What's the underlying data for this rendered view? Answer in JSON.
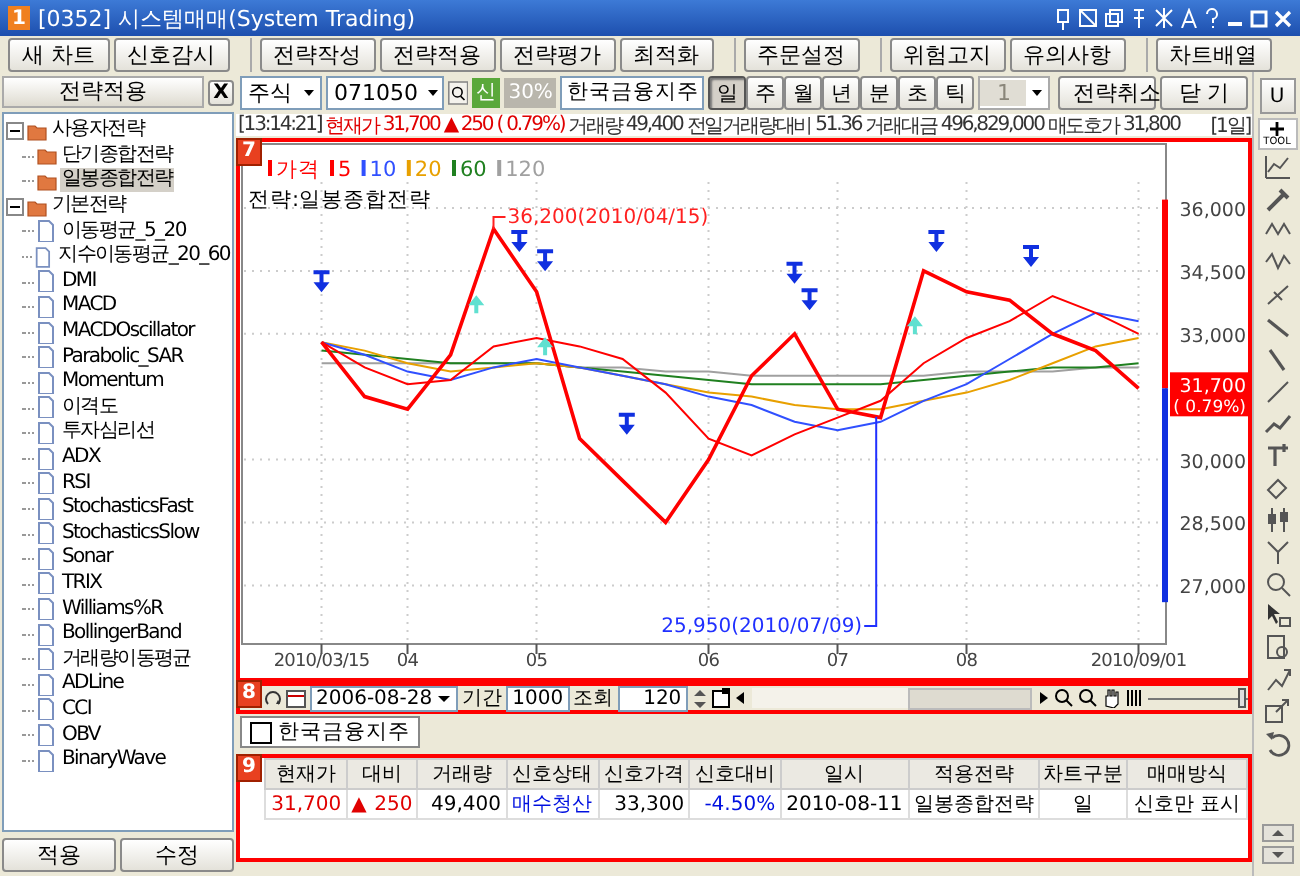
{
  "window": {
    "badge": "1",
    "title": "[0352] 시스템매매(System Trading)"
  },
  "toolbar": {
    "groups": [
      [
        "새 차트",
        "신호감시"
      ],
      [
        "전략작성",
        "전략적용",
        "전략평가",
        "최적화"
      ],
      [
        "주문설정"
      ],
      [
        "위험고지",
        "유의사항"
      ],
      [
        "차트배열"
      ]
    ]
  },
  "sidebar": {
    "title": "전략적용",
    "close": "X",
    "tree": [
      {
        "label": "사용자전략",
        "kind": "folder",
        "expanded": true,
        "selected": false,
        "children": [
          {
            "label": "단기종합전략",
            "kind": "folder",
            "selected": false
          },
          {
            "label": "일봉종합전략",
            "kind": "folder",
            "selected": true
          }
        ]
      },
      {
        "label": "기본전략",
        "kind": "folder",
        "expanded": true,
        "selected": false,
        "children": [
          {
            "label": "이동평균_5_20",
            "kind": "file",
            "selected": false
          },
          {
            "label": "지수이동평균_20_60",
            "kind": "file",
            "selected": false
          },
          {
            "label": "DMI",
            "kind": "file",
            "selected": false
          },
          {
            "label": "MACD",
            "kind": "file",
            "selected": false
          },
          {
            "label": "MACDOscillator",
            "kind": "file",
            "selected": false
          },
          {
            "label": "Parabolic_SAR",
            "kind": "file",
            "selected": false
          },
          {
            "label": "Momentum",
            "kind": "file",
            "selected": false
          },
          {
            "label": "이격도",
            "kind": "file",
            "selected": false
          },
          {
            "label": "투자심리선",
            "kind": "file",
            "selected": false
          },
          {
            "label": "ADX",
            "kind": "file",
            "selected": false
          },
          {
            "label": "RSI",
            "kind": "file",
            "selected": false
          },
          {
            "label": "StochasticsFast",
            "kind": "file",
            "selected": false
          },
          {
            "label": "StochasticsSlow",
            "kind": "file",
            "selected": false
          },
          {
            "label": "Sonar",
            "kind": "file",
            "selected": false
          },
          {
            "label": "TRIX",
            "kind": "file",
            "selected": false
          },
          {
            "label": "Williams%R",
            "kind": "file",
            "selected": false
          },
          {
            "label": "BollingerBand",
            "kind": "file",
            "selected": false
          },
          {
            "label": "거래량이동평균",
            "kind": "file",
            "selected": false
          },
          {
            "label": "ADLine",
            "kind": "file",
            "selected": false
          },
          {
            "label": "CCI",
            "kind": "file",
            "selected": false
          },
          {
            "label": "OBV",
            "kind": "file",
            "selected": false
          },
          {
            "label": "BinaryWave",
            "kind": "file",
            "selected": false
          }
        ]
      }
    ],
    "buttons": [
      "적용",
      "수정"
    ]
  },
  "controls": {
    "market": "주식",
    "code": "071050",
    "badges": [
      {
        "label": "신",
        "kind": "new"
      },
      {
        "label": "30%",
        "kind": "margin"
      }
    ],
    "name": "한국금융지주",
    "periods": [
      {
        "label": "일",
        "selected": true
      },
      {
        "label": "주",
        "selected": false
      },
      {
        "label": "월",
        "selected": false
      },
      {
        "label": "년",
        "selected": false
      },
      {
        "label": "분",
        "selected": false
      },
      {
        "label": "초",
        "selected": false
      },
      {
        "label": "틱",
        "selected": false
      }
    ],
    "unit": {
      "value": "1",
      "disabled": true
    },
    "buttons": [
      "전략취소",
      "닫 기"
    ]
  },
  "quote": {
    "time": "[13:14:21]",
    "label": "현재가",
    "price": "31,700",
    "arrow": "▲",
    "change": "250",
    "rate": "( 0.79%)",
    "color": "#e00000",
    "stats": [
      {
        "label": "거래량",
        "value": "49,400"
      },
      {
        "label": "전일거래량대비",
        "value": "51.36"
      },
      {
        "label": "거래대금",
        "value": "496,829,000"
      },
      {
        "label": "매도호가",
        "value": "31,800"
      }
    ],
    "period": "[1일]"
  },
  "chart": {
    "badge": "7",
    "strategy": "전략:일봉종합전략",
    "price_tag": {
      "price": "31,700",
      "rate": "( 0.79%)"
    },
    "chart_data": {
      "type": "line",
      "grid": true,
      "legend": "top left",
      "categories": [
        "2010/03/15",
        null,
        "04",
        null,
        null,
        "05",
        null,
        null,
        null,
        "06",
        null,
        null,
        "07",
        null,
        null,
        "08",
        null,
        null,
        null,
        "2010/09/01"
      ],
      "ylim": [
        25650,
        36620
      ],
      "series": [
        {
          "name": "가격",
          "color": "#ff0000",
          "values": [
            32800,
            31500,
            31200,
            32500,
            35500,
            34000,
            30500,
            29500,
            28500,
            30000,
            32000,
            33000,
            31200,
            31000,
            34500,
            34000,
            33800,
            33000,
            32600,
            31700
          ]
        },
        {
          "name": "5",
          "color": "#ff0000",
          "values": [
            32800,
            32200,
            31800,
            31900,
            32700,
            32900,
            32700,
            32400,
            31600,
            30500,
            30100,
            30600,
            31000,
            31400,
            32300,
            32900,
            33300,
            33900,
            33500,
            33000
          ]
        },
        {
          "name": "10",
          "color": "#3050ff",
          "values": [
            32800,
            32500,
            32100,
            31900,
            32200,
            32400,
            32200,
            32000,
            31800,
            31500,
            31300,
            30900,
            30700,
            30900,
            31400,
            31800,
            32400,
            33000,
            33500,
            33300
          ]
        },
        {
          "name": "20",
          "color": "#e8a000",
          "values": [
            32800,
            32600,
            32300,
            32100,
            32200,
            32300,
            32200,
            32000,
            31800,
            31600,
            31500,
            31300,
            31200,
            31200,
            31400,
            31600,
            31900,
            32300,
            32700,
            32900
          ]
        },
        {
          "name": "60",
          "color": "#208020",
          "values": [
            32600,
            32500,
            32400,
            32300,
            32300,
            32300,
            32200,
            32100,
            32000,
            31900,
            31800,
            31800,
            31800,
            31800,
            31900,
            32000,
            32100,
            32200,
            32200,
            32300
          ]
        },
        {
          "name": "120",
          "color": "#a0a0a0",
          "values": [
            32300,
            32300,
            32300,
            32300,
            32300,
            32300,
            32200,
            32200,
            32100,
            32100,
            32000,
            32000,
            32000,
            32000,
            32000,
            32100,
            32100,
            32100,
            32200,
            32200
          ]
        }
      ],
      "yticks": [
        {
          "value": 27000,
          "label": "27,000"
        },
        {
          "value": 28500,
          "label": "28,500"
        },
        {
          "value": 30000,
          "label": "30,000"
        },
        {
          "value": 33000,
          "label": "33,000"
        },
        {
          "value": 34500,
          "label": "34,500"
        },
        {
          "value": 36000,
          "label": "36,000"
        }
      ],
      "annotations": [
        "36,200(2010/04/15)",
        "25,950(2010/07/09)"
      ]
    }
  },
  "chart_bar": {
    "badge": "8",
    "date": "2006-08-28",
    "period_label": "기간",
    "period": "1000",
    "query_label": "조회",
    "count": "120",
    "zoom": {
      "level": 1
    }
  },
  "symbol_tab": {
    "label": "한국금융지주",
    "checked": false
  },
  "signals": {
    "badge": "9",
    "columns": [
      "현재가",
      "대비",
      "거래량",
      "신호상태",
      "신호가격",
      "신호대비",
      "일시",
      "적용전략",
      "차트구분",
      "매매방식"
    ],
    "rows": [
      [
        {
          "text": "31,700",
          "kind": "number",
          "color": "#e00000"
        },
        {
          "text": "250",
          "kind": "number",
          "color": "#e00000",
          "arrow": "▲"
        },
        {
          "text": "49,400",
          "kind": "number"
        },
        {
          "text": "매수청산",
          "kind": "text",
          "color": "#0010e0"
        },
        {
          "text": "33,300",
          "kind": "number"
        },
        {
          "text": "-4.50%",
          "kind": "number",
          "color": "#0010e0"
        },
        {
          "text": "2010-08-11",
          "kind": "text"
        },
        {
          "text": "일봉종합전략",
          "kind": "text"
        },
        {
          "text": "일",
          "kind": "text"
        },
        {
          "text": "신호만 표시",
          "kind": "text"
        }
      ]
    ]
  },
  "tools": {
    "top": "U",
    "tool_label": "TOOL"
  }
}
